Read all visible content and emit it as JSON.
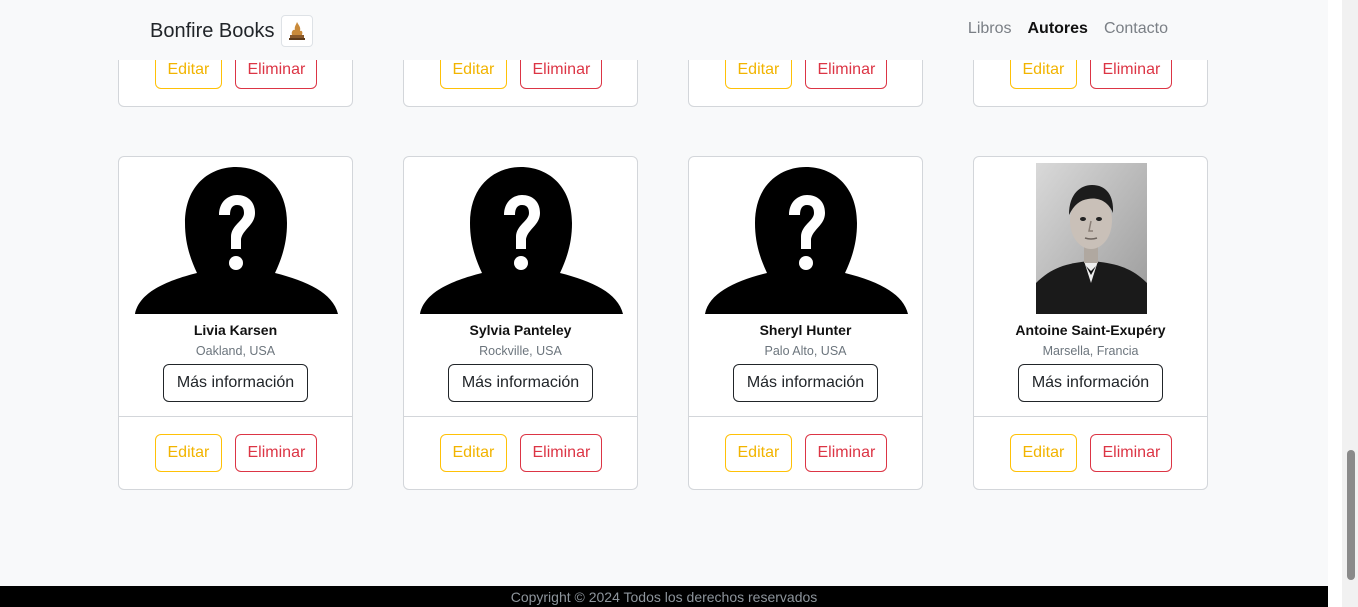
{
  "navbar": {
    "brand": "Bonfire Books",
    "links": [
      "Libros",
      "Autores",
      "Contacto"
    ],
    "active": "Autores"
  },
  "actions": {
    "edit": "Editar",
    "delete": "Eliminar",
    "more": "Más información"
  },
  "authors_top_row_partial": 4,
  "authors": [
    {
      "name": "Livia Karsen",
      "location": "Oakland, USA",
      "photo": "unknown-silhouette"
    },
    {
      "name": "Sylvia Panteley",
      "location": "Rockville, USA",
      "photo": "unknown-silhouette"
    },
    {
      "name": "Sheryl Hunter",
      "location": "Palo Alto, USA",
      "photo": "unknown-silhouette"
    },
    {
      "name": "Antoine Saint-Exupéry",
      "location": "Marsella, Francia",
      "photo": "portrait"
    }
  ],
  "footer": {
    "copyright": "Copyright © 2024 Todos los derechos reservados"
  },
  "colors": {
    "edit": "#ffc107",
    "delete": "#dc3545",
    "footer_bg": "#000000"
  }
}
